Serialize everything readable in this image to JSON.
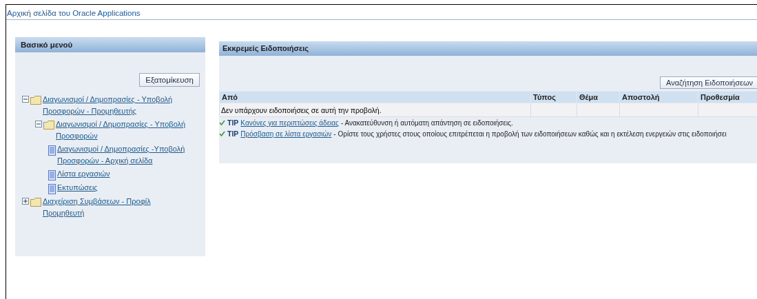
{
  "window": {
    "title": "Αρχική σελίδα του Oracle Applications"
  },
  "main_menu": {
    "title": "Βασικό μενού",
    "personalize_button": "Εξατομίκευση",
    "tree": [
      {
        "kind": "folder",
        "label": "Διαγωνισμοί / Δημοπρασίες - Υποβολή Προσφορών - Προμηθευτής",
        "expanded": true,
        "children": [
          {
            "kind": "folder",
            "label": "Διαγωνισμοί / Δημοπρασίες - Υποβολή Προσφορών",
            "expanded": true,
            "children": [
              {
                "kind": "page",
                "label": "Διαγωνισμοί / Δημοπρασίες -Υποβολή Προσφορών - Αρχική σελίδα"
              },
              {
                "kind": "page",
                "label": "Λίστα εργασιών"
              },
              {
                "kind": "page",
                "label": "Εκτυπώσεις"
              }
            ]
          }
        ]
      },
      {
        "kind": "folder",
        "label": "Διαχείριση Συμβάσεων - Προφίλ Προμηθευτή",
        "expanded": false
      }
    ]
  },
  "notifications": {
    "title": "Εκκρεμείς Ειδοποιήσεις",
    "search_button": "Αναζήτηση Ειδοποιήσεων",
    "table": {
      "columns": [
        "Από",
        "Τύπος",
        "Θέμα",
        "Αποστολή",
        "Προθεσμία"
      ],
      "rows": [
        [
          "Δεν υπάρχουν ειδοποιήσεις σε αυτή την προβολή.",
          "",
          "",
          "",
          ""
        ]
      ]
    },
    "tips": [
      {
        "label": "TIP",
        "link": "Κανόνες για περιπτώσεις άδειας",
        "text": "- Ανακατεύθυνση ή αυτόματη απάντηση σε ειδοποιήσεις."
      },
      {
        "label": "TIP",
        "link": "Πρόσβαση σε λίστα εργασιών",
        "text": "- Ορίστε τους χρήστες στους οποίους επιτρέπεται η προβολή των ειδοποιήσεων καθώς και η εκτέλεση ενεργειών στις ειδοποιήσει"
      }
    ]
  }
}
